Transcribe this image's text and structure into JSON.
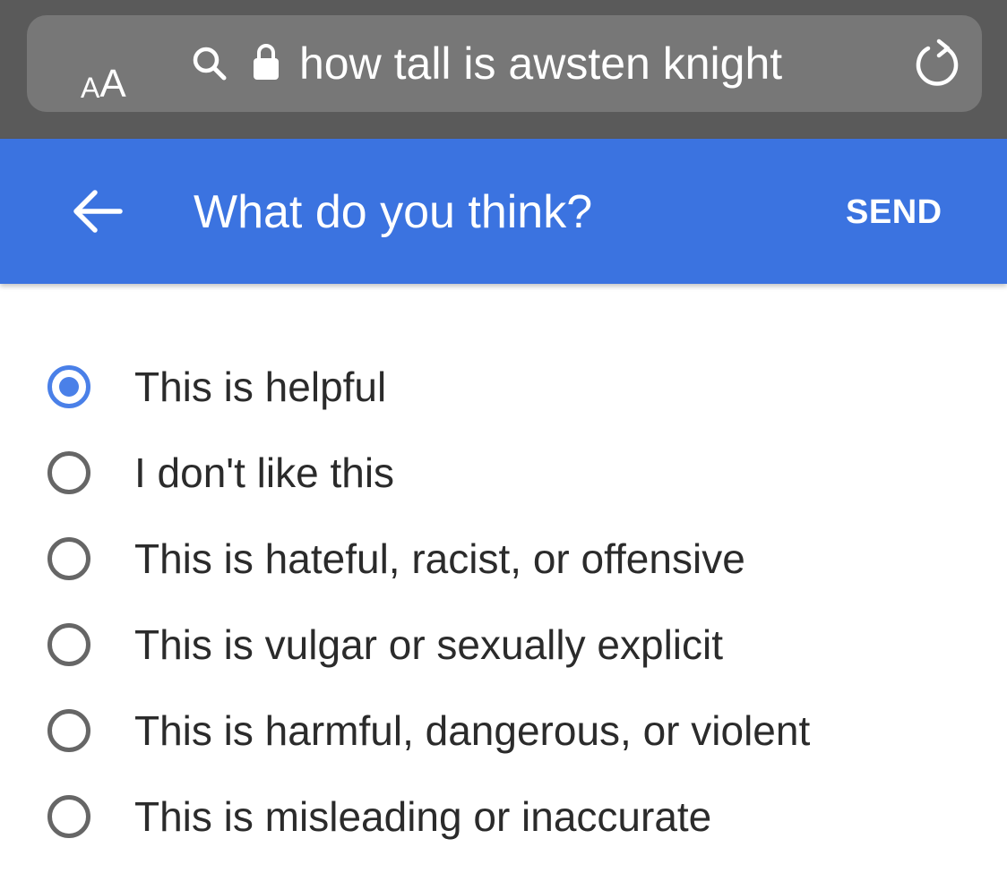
{
  "browser": {
    "reader_small": "A",
    "reader_large": "A",
    "url_text": "how tall is awsten knight",
    "icons": {
      "reader": "text-size-icon",
      "search": "search-icon",
      "lock": "lock-icon",
      "reload": "reload-icon"
    }
  },
  "header": {
    "back_icon": "back-arrow-icon",
    "title": "What do you think?",
    "send_label": "SEND",
    "color": "#3b73e0"
  },
  "options": [
    {
      "label": "This is helpful",
      "selected": true
    },
    {
      "label": "I don't like this",
      "selected": false
    },
    {
      "label": "This is hateful, racist, or offensive",
      "selected": false
    },
    {
      "label": "This is vulgar or sexually explicit",
      "selected": false
    },
    {
      "label": "This is harmful, dangerous, or violent",
      "selected": false
    },
    {
      "label": "This is misleading or inaccurate",
      "selected": false
    }
  ],
  "colors": {
    "radio_selected": "#4a80e8",
    "radio_unselected": "#666666",
    "text": "#2b2b2b"
  }
}
